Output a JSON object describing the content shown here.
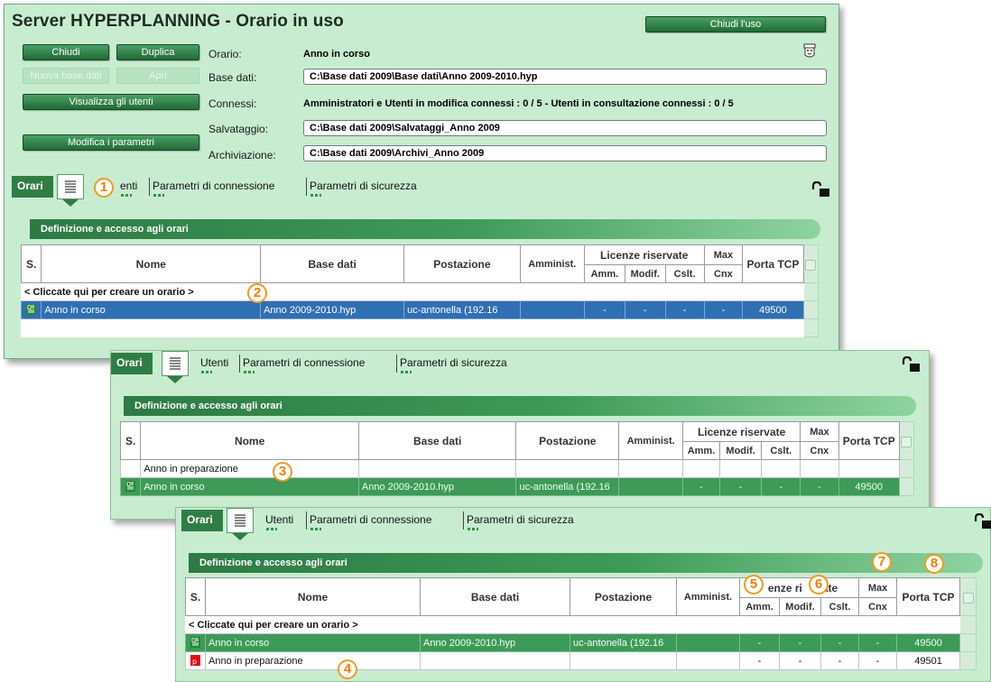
{
  "window": {
    "title": "Server HYPERPLANNING - Orario in uso",
    "close_use_button": "Chiudi l'uso"
  },
  "buttons": {
    "chiudi": "Chiudi",
    "duplica": "Duplica",
    "nuova_base_dati": "Nuova base dati",
    "apri": "Apri",
    "visualizza_utenti": "Visualizza gli utenti",
    "modifica_parametri": "Modifica i parametri"
  },
  "fields": {
    "orario_label": "Orario:",
    "orario_value": "Anno in corso",
    "base_dati_label": "Base dati:",
    "base_dati_value": "C:\\Base dati 2009\\Base dati\\Anno 2009-2010.hyp",
    "connessi_label": "Connessi:",
    "connessi_value": "Amministratori e Utenti in modifica connessi : 0 / 5 - Utenti in consultazione connessi : 0 / 5",
    "salvataggio_label": "Salvataggio:",
    "salvataggio_value": "C:\\Base dati 2009\\Salvataggi_Anno 2009",
    "archiviazione_label": "Archiviazione:",
    "archiviazione_value": "C:\\Base dati 2009\\Archivi_Anno 2009"
  },
  "tabs": {
    "orari": "Orari",
    "utenti": "Utenti",
    "utenti_partial": "enti",
    "parametri_connessione": "Parametri di connessione",
    "parametri_sicurezza": "Parametri di sicurezza"
  },
  "section_title": "Definizione e accesso agli orari",
  "table": {
    "headers": {
      "s": "S.",
      "nome": "Nome",
      "base_dati": "Base dati",
      "postazione": "Postazione",
      "amminist": "Amminist.",
      "licenze": "Licenze riservate",
      "amm": "Amm.",
      "modif": "Modif.",
      "cslt": "Cslt.",
      "max": "Max",
      "cnx": "Cnx",
      "porta": "Porta TCP"
    },
    "header_fragments": {
      "licenze_a": "enze ri",
      "licenze_b": "ate"
    },
    "create_row": "< Cliccate qui per creare un orario >",
    "rows": {
      "corso": {
        "nome": "Anno in corso",
        "base_dati": "Anno 2009-2010.hyp",
        "postazione": "uc-antonella (192.16",
        "dash": "-",
        "porta": "49500"
      },
      "preparazione": {
        "nome": "Anno in preparazione",
        "dash": "-",
        "porta": "49501"
      }
    }
  },
  "callouts": [
    "1",
    "2",
    "3",
    "4",
    "5",
    "6",
    "7",
    "8"
  ],
  "colors": {
    "panel_bg": "#c8ecd0",
    "button_green": "#2f7d45",
    "selection_blue": "#2f6fb4",
    "row_green": "#3d9a58",
    "callout_orange": "#f39a1c"
  }
}
